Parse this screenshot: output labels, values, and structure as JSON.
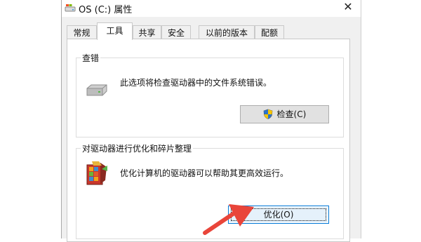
{
  "window": {
    "title": "OS (C:) 属性",
    "close_glyph": "✕"
  },
  "tabs": [
    {
      "label": "常规"
    },
    {
      "label": "工具"
    },
    {
      "label": "共享"
    },
    {
      "label": "安全"
    },
    {
      "label": "以前的版本"
    },
    {
      "label": "配额"
    }
  ],
  "active_tab": "工具",
  "error_check": {
    "group_label": "查错",
    "description": "此选项将检查驱动器中的文件系统错误。",
    "button_label": "检查(C)",
    "icon": "drive-icon",
    "button_icon": "uac-shield-icon"
  },
  "optimize": {
    "group_label": "对驱动器进行优化和碎片整理",
    "description": "优化计算机的驱动器可以帮助其更高效运行。",
    "button_label": "优化(O)",
    "icon": "defrag-icon"
  },
  "colors": {
    "accent_focus": "#0078d7",
    "arrow": "#e9453a"
  }
}
